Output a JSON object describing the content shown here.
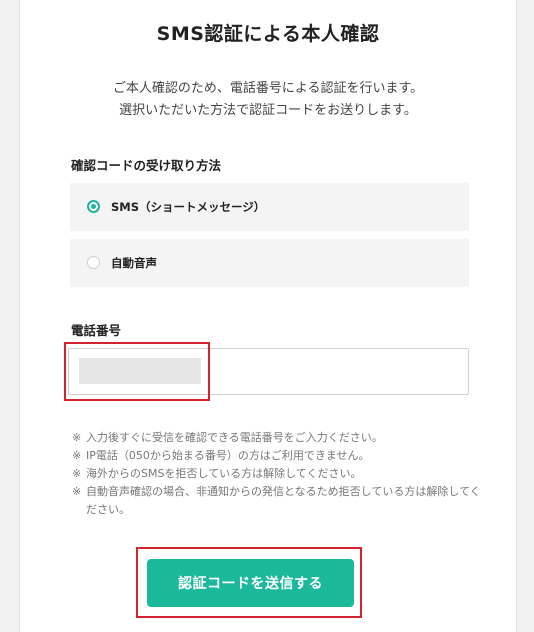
{
  "page": {
    "title": "SMS認証による本人確認",
    "intro_lines": [
      "ご本人確認のため、電話番号による認証を行います。",
      "選択いただいた方法で認証コードをお送りします。"
    ]
  },
  "method": {
    "label": "確認コードの受け取り方法",
    "options": [
      {
        "label": "SMS（ショートメッセージ）",
        "selected": true
      },
      {
        "label": "自動音声",
        "selected": false
      }
    ]
  },
  "phone": {
    "label": "電話番号",
    "value": ""
  },
  "notes": [
    "入力後すぐに受信を確認できる電話番号をご入力ください。",
    "IP電話（050から始まる番号）の方はご利用できません。",
    "海外からのSMSを拒否している方は解除してください。",
    "自動音声確認の場合、非通知からの発信となるため拒否している方は解除してください。"
  ],
  "submit": {
    "label": "認証コードを送信する"
  },
  "colors": {
    "accent": "#1cb89b",
    "highlight": "#d1242f"
  }
}
